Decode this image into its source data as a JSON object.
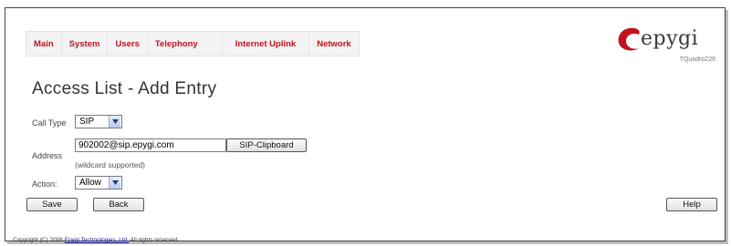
{
  "nav": {
    "items": [
      "Main",
      "System",
      "Users",
      "Telephony",
      "Internet Uplink",
      "Network"
    ]
  },
  "logo": {
    "word": "epygi",
    "model": "TQuadro226",
    "brand_color": "#c0121f"
  },
  "page_title": "Access List - Add Entry",
  "form": {
    "call_type": {
      "label": "Call Type",
      "value": "SIP"
    },
    "address": {
      "label": "Address",
      "value": "902002@sip.epygi.com",
      "clipboard_button": "SIP-Clipboard",
      "hint": "(wildcard supported)"
    },
    "action": {
      "label": "Action:",
      "value": "Allow"
    }
  },
  "buttons": {
    "save": "Save",
    "back": "Back",
    "help": "Help"
  },
  "footer": {
    "prefix": "Copyright (C) 2006 ",
    "link": "Epygi Technologies, Ltd.",
    "suffix": " All rights reserved."
  }
}
